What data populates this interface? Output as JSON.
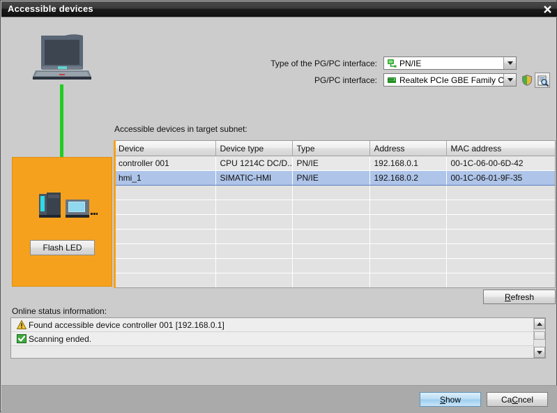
{
  "window": {
    "title": "Accessible devices",
    "close_icon": "close-icon"
  },
  "graphic": {
    "laptop_icon": "laptop-icon",
    "cable_icon": "network-cable",
    "devices_icon": "plc-hmi-devices-icon",
    "flash_led_label": "Flash LED",
    "panel_color": "#f5a11e",
    "cable_color": "#22cc22"
  },
  "interface": {
    "type_label": "Type of the PG/PC interface:",
    "type_value": "PN/IE",
    "type_icon": "network-interface-icon",
    "pgpc_label": "PG/PC interface:",
    "pgpc_value": "Realtek PCIe GBE Family C...",
    "pgpc_icon": "network-adapter-icon",
    "shield_button_icon": "shield-icon",
    "inspect_button_icon": "properties-magnifier-icon",
    "dropdown_icon": "chevron-down-icon"
  },
  "table": {
    "caption": "Accessible devices in target subnet:",
    "columns": [
      "Device",
      "Device type",
      "Type",
      "Address",
      "MAC address"
    ],
    "rows": [
      {
        "device": "controller 001",
        "device_type": "CPU 1214C DC/D...",
        "type": "PN/IE",
        "address": "192.168.0.1",
        "mac": "00-1C-06-00-6D-42",
        "selected": false
      },
      {
        "device": "hmi_1",
        "device_type": "SIMATIC-HMI",
        "type": "PN/IE",
        "address": "192.168.0.2",
        "mac": "00-1C-06-01-9F-35",
        "selected": true
      }
    ],
    "empty_row_count": 8,
    "selection_color": "#aec4e8"
  },
  "refresh": {
    "label": "Refresh",
    "accel": "R"
  },
  "status": {
    "label": "Online status information:",
    "messages": [
      {
        "icon": "warning-icon",
        "text": "Found accessible device controller 001 [192.168.0.1]"
      },
      {
        "icon": "success-check-icon",
        "text": "Scanning ended."
      }
    ],
    "scroll_up_icon": "scroll-up-arrow-icon",
    "scroll_down_icon": "scroll-down-arrow-icon"
  },
  "footer": {
    "show_label": "Show",
    "show_accel": "S",
    "cancel_label": "Cancel",
    "cancel_accel": "C"
  }
}
